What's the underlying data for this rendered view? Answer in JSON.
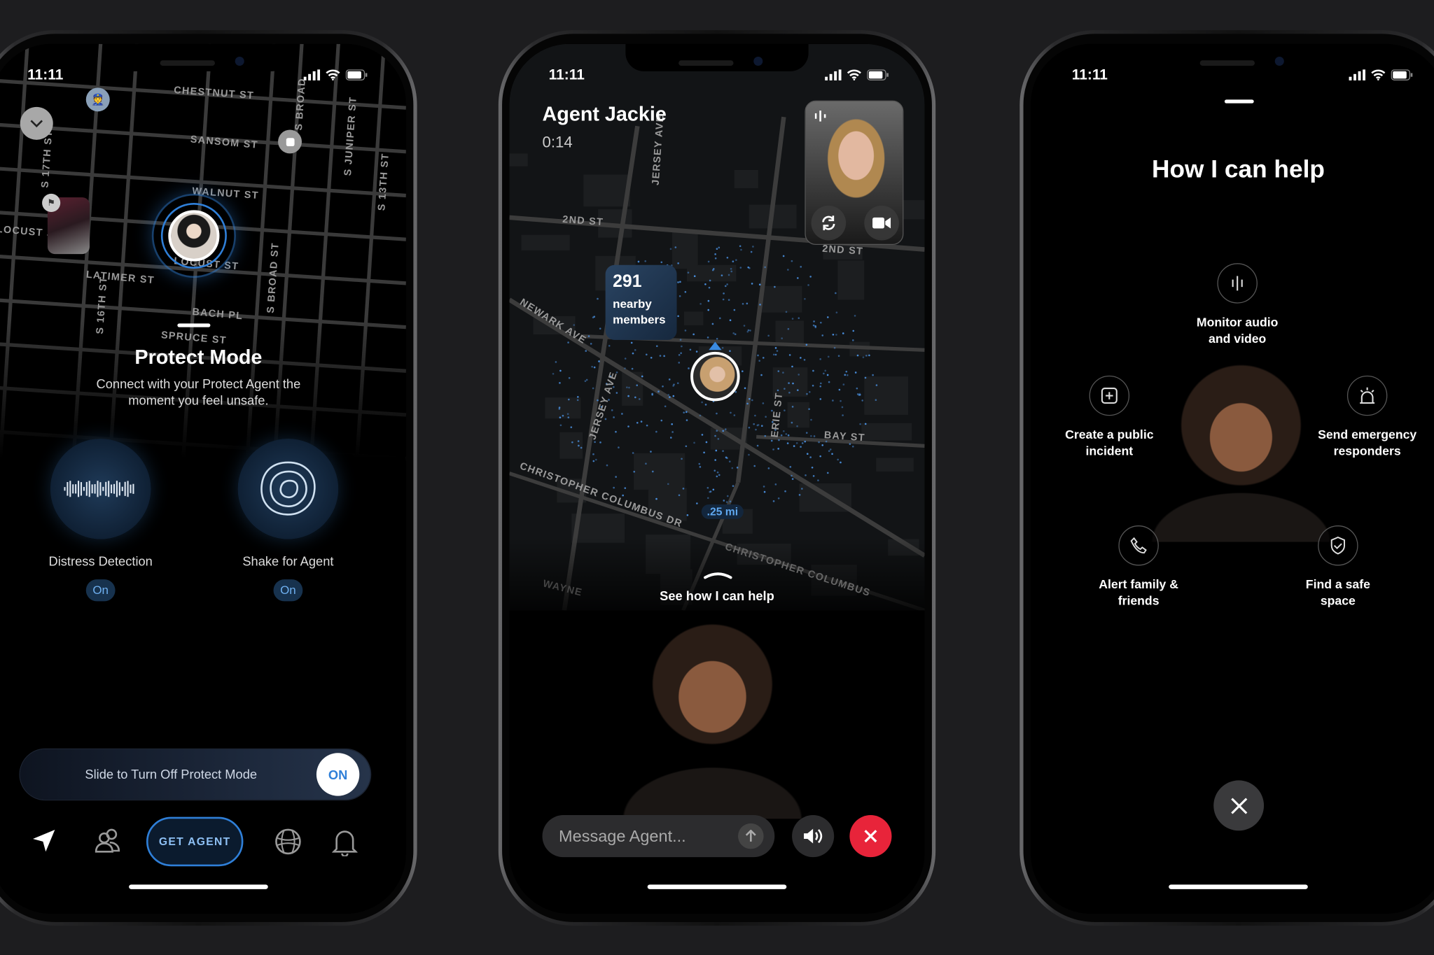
{
  "status_time": "11:11",
  "colors": {
    "accent_blue": "#2f7fd8",
    "end_call_red": "#e8243a",
    "background": "#1d1d1f"
  },
  "phone1": {
    "streets": [
      "CHESTNUT ST",
      "SANSOM ST",
      "WALNUT ST",
      "LOCUST ST",
      "LATIMER ST",
      "BACH PL",
      "SPRUCE ST",
      "S 17TH ST",
      "S 16TH ST",
      "S BROAD ST",
      "S BROAD",
      "S JUNIPER ST",
      "S 13TH ST",
      "LOCUST ST"
    ],
    "title": "Protect Mode",
    "subtitle_line1": "Connect with your Protect Agent the",
    "subtitle_line2": "moment you feel unsafe.",
    "features": [
      {
        "label": "Distress Detection",
        "state": "On",
        "icon": "waveform-icon"
      },
      {
        "label": "Shake for Agent",
        "state": "On",
        "icon": "shake-rings-icon"
      }
    ],
    "slider": {
      "label": "Slide to Turn Off Protect Mode",
      "knob": "ON"
    },
    "nav": {
      "get_agent": "GET AGENT",
      "icons": [
        "location-arrow-icon",
        "people-icon",
        "globe-icon",
        "bell-icon"
      ]
    }
  },
  "phone2": {
    "agent_name": "Agent Jackie",
    "call_duration": "0:14",
    "streets": [
      "2ND ST",
      "2ND ST",
      "JERSEY AVE",
      "NEWARK AVE",
      "JERSEY AVE",
      "ERIE ST",
      "BAY ST",
      "CHRISTOPHER COLUMBUS DR",
      "CHRISTOPHER COLUMBUS",
      "WAYNE"
    ],
    "nearby_count": "291",
    "nearby_label_1": "nearby",
    "nearby_label_2": "members",
    "radius_label": ".25 mi",
    "see_help": "See how I can help",
    "message_placeholder": "Message Agent..."
  },
  "phone3": {
    "title": "How I can help",
    "items": [
      {
        "l1": "Monitor audio",
        "l2": "and video",
        "icon": "audio-bars-icon"
      },
      {
        "l1": "Create a public",
        "l2": "incident",
        "icon": "plus-square-icon"
      },
      {
        "l1": "Send emergency",
        "l2": "responders",
        "icon": "siren-icon"
      },
      {
        "l1": "Alert family &",
        "l2": "friends",
        "icon": "phone-icon"
      },
      {
        "l1": "Find a safe",
        "l2": "space",
        "icon": "shield-check-icon"
      }
    ]
  }
}
